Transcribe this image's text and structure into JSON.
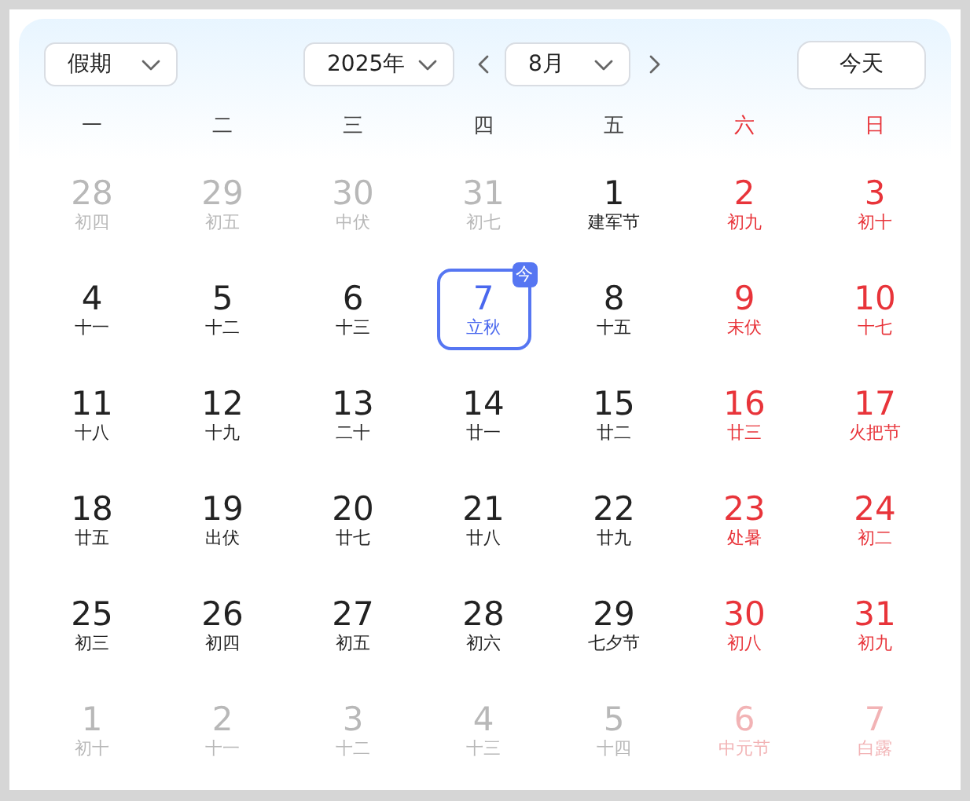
{
  "holiday_select": {
    "value": "假期"
  },
  "year_select": {
    "value": "2025年"
  },
  "month_select": {
    "value": "8月"
  },
  "today_button": {
    "label": "今天"
  },
  "weekdays": [
    {
      "label": "一",
      "weekend": false
    },
    {
      "label": "二",
      "weekend": false
    },
    {
      "label": "三",
      "weekend": false
    },
    {
      "label": "四",
      "weekend": false
    },
    {
      "label": "五",
      "weekend": false
    },
    {
      "label": "六",
      "weekend": true
    },
    {
      "label": "日",
      "weekend": true
    }
  ],
  "weeks": [
    {
      "days": [
        {
          "day": "28",
          "lunar": "初四",
          "in_month": false,
          "weekend": false,
          "selected": false
        },
        {
          "day": "29",
          "lunar": "初五",
          "in_month": false,
          "weekend": false,
          "selected": false
        },
        {
          "day": "30",
          "lunar": "中伏",
          "in_month": false,
          "weekend": false,
          "selected": false
        },
        {
          "day": "31",
          "lunar": "初七",
          "in_month": false,
          "weekend": false,
          "selected": false
        },
        {
          "day": "1",
          "lunar": "建军节",
          "in_month": true,
          "weekend": false,
          "selected": false
        },
        {
          "day": "2",
          "lunar": "初九",
          "in_month": true,
          "weekend": true,
          "selected": false
        },
        {
          "day": "3",
          "lunar": "初十",
          "in_month": true,
          "weekend": true,
          "selected": false
        }
      ]
    },
    {
      "days": [
        {
          "day": "4",
          "lunar": "十一",
          "in_month": true,
          "weekend": false,
          "selected": false
        },
        {
          "day": "5",
          "lunar": "十二",
          "in_month": true,
          "weekend": false,
          "selected": false
        },
        {
          "day": "6",
          "lunar": "十三",
          "in_month": true,
          "weekend": false,
          "selected": false
        },
        {
          "day": "7",
          "lunar": "立秋",
          "in_month": true,
          "weekend": false,
          "selected": true,
          "badge": "今"
        },
        {
          "day": "8",
          "lunar": "十五",
          "in_month": true,
          "weekend": false,
          "selected": false
        },
        {
          "day": "9",
          "lunar": "末伏",
          "in_month": true,
          "weekend": true,
          "selected": false
        },
        {
          "day": "10",
          "lunar": "十七",
          "in_month": true,
          "weekend": true,
          "selected": false
        }
      ]
    },
    {
      "days": [
        {
          "day": "11",
          "lunar": "十八",
          "in_month": true,
          "weekend": false,
          "selected": false
        },
        {
          "day": "12",
          "lunar": "十九",
          "in_month": true,
          "weekend": false,
          "selected": false
        },
        {
          "day": "13",
          "lunar": "二十",
          "in_month": true,
          "weekend": false,
          "selected": false
        },
        {
          "day": "14",
          "lunar": "廿一",
          "in_month": true,
          "weekend": false,
          "selected": false
        },
        {
          "day": "15",
          "lunar": "廿二",
          "in_month": true,
          "weekend": false,
          "selected": false
        },
        {
          "day": "16",
          "lunar": "廿三",
          "in_month": true,
          "weekend": true,
          "selected": false
        },
        {
          "day": "17",
          "lunar": "火把节",
          "in_month": true,
          "weekend": true,
          "selected": false
        }
      ]
    },
    {
      "days": [
        {
          "day": "18",
          "lunar": "廿五",
          "in_month": true,
          "weekend": false,
          "selected": false
        },
        {
          "day": "19",
          "lunar": "出伏",
          "in_month": true,
          "weekend": false,
          "selected": false
        },
        {
          "day": "20",
          "lunar": "廿七",
          "in_month": true,
          "weekend": false,
          "selected": false
        },
        {
          "day": "21",
          "lunar": "廿八",
          "in_month": true,
          "weekend": false,
          "selected": false
        },
        {
          "day": "22",
          "lunar": "廿九",
          "in_month": true,
          "weekend": false,
          "selected": false
        },
        {
          "day": "23",
          "lunar": "处暑",
          "in_month": true,
          "weekend": true,
          "selected": false
        },
        {
          "day": "24",
          "lunar": "初二",
          "in_month": true,
          "weekend": true,
          "selected": false
        }
      ]
    },
    {
      "days": [
        {
          "day": "25",
          "lunar": "初三",
          "in_month": true,
          "weekend": false,
          "selected": false
        },
        {
          "day": "26",
          "lunar": "初四",
          "in_month": true,
          "weekend": false,
          "selected": false
        },
        {
          "day": "27",
          "lunar": "初五",
          "in_month": true,
          "weekend": false,
          "selected": false
        },
        {
          "day": "28",
          "lunar": "初六",
          "in_month": true,
          "weekend": false,
          "selected": false
        },
        {
          "day": "29",
          "lunar": "七夕节",
          "in_month": true,
          "weekend": false,
          "selected": false
        },
        {
          "day": "30",
          "lunar": "初八",
          "in_month": true,
          "weekend": true,
          "selected": false
        },
        {
          "day": "31",
          "lunar": "初九",
          "in_month": true,
          "weekend": true,
          "selected": false
        }
      ]
    },
    {
      "days": [
        {
          "day": "1",
          "lunar": "初十",
          "in_month": false,
          "weekend": false,
          "selected": false
        },
        {
          "day": "2",
          "lunar": "十一",
          "in_month": false,
          "weekend": false,
          "selected": false
        },
        {
          "day": "3",
          "lunar": "十二",
          "in_month": false,
          "weekend": false,
          "selected": false
        },
        {
          "day": "4",
          "lunar": "十三",
          "in_month": false,
          "weekend": false,
          "selected": false
        },
        {
          "day": "5",
          "lunar": "十四",
          "in_month": false,
          "weekend": false,
          "selected": false
        },
        {
          "day": "6",
          "lunar": "中元节",
          "in_month": false,
          "weekend": true,
          "selected": false
        },
        {
          "day": "7",
          "lunar": "白露",
          "in_month": false,
          "weekend": true,
          "selected": false
        }
      ]
    }
  ]
}
